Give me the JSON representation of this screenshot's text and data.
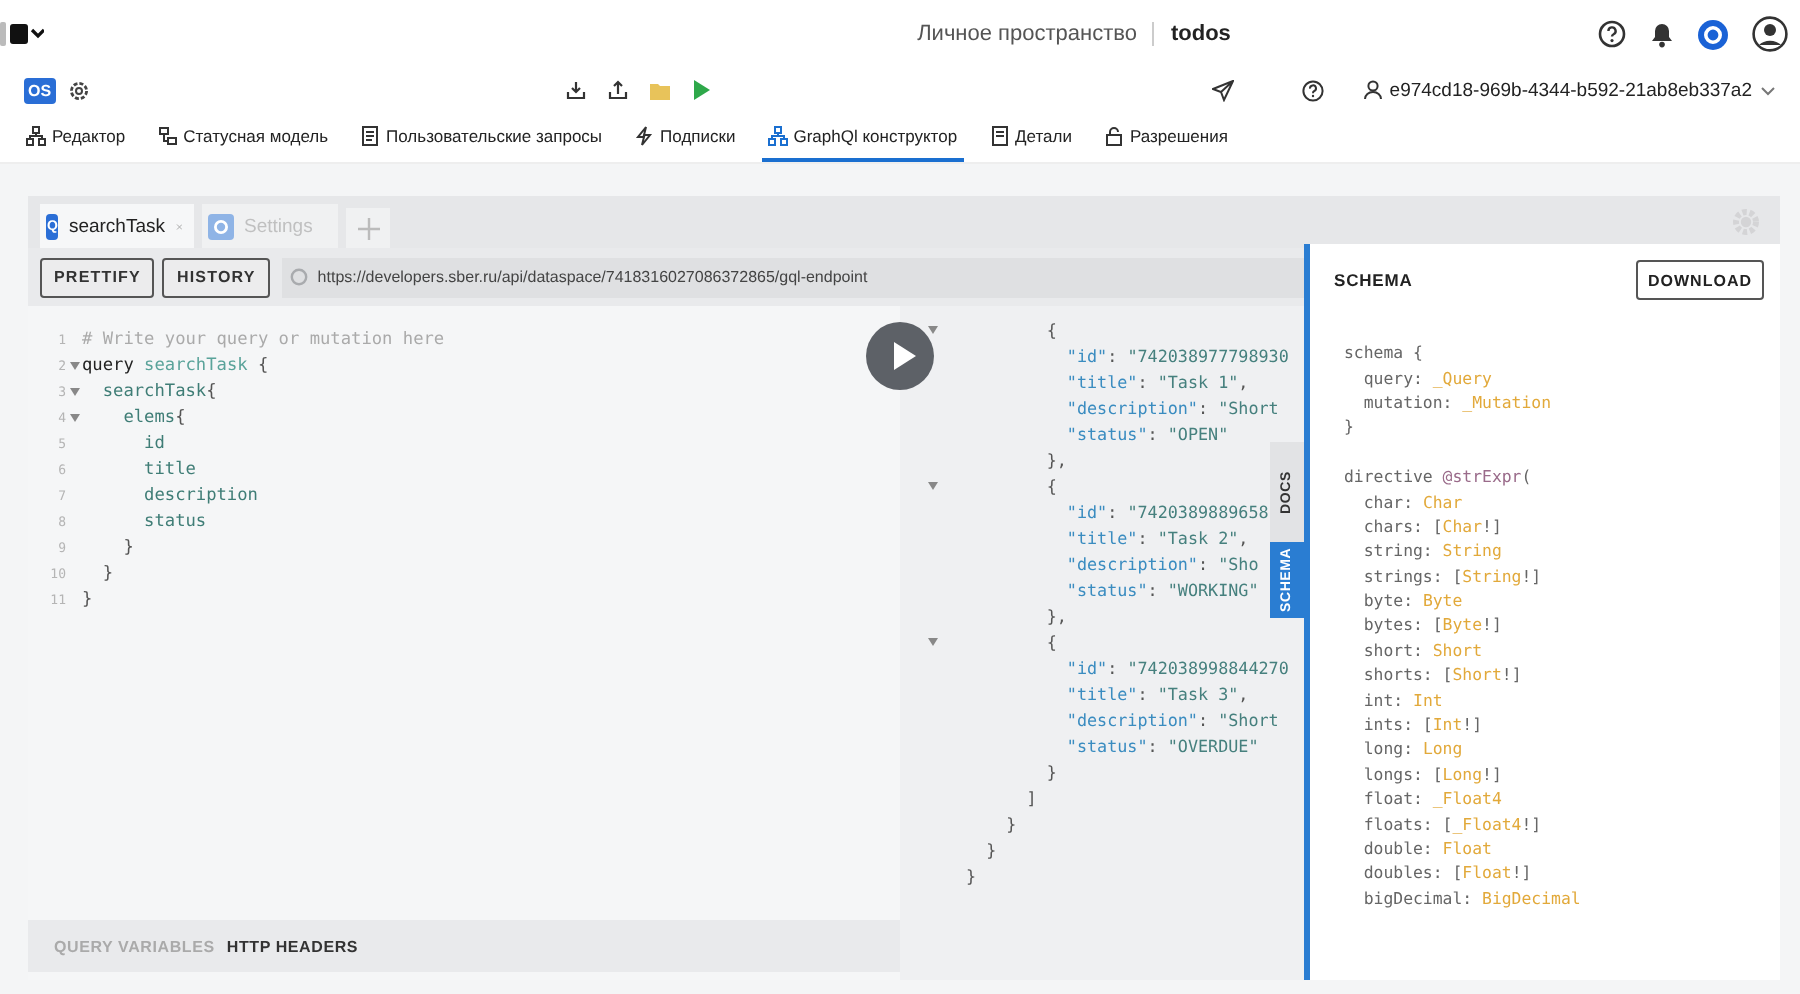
{
  "header": {
    "workspace": "Личное пространство",
    "project": "todos"
  },
  "toolbar": {
    "badge": "OS",
    "user_id": "e974cd18-969b-4344-b592-21ab8eb337a2"
  },
  "nav_tabs": [
    {
      "label": "Редактор",
      "selected": false
    },
    {
      "label": "Статусная модель",
      "selected": false
    },
    {
      "label": "Пользовательские запросы",
      "selected": false
    },
    {
      "label": "Подписки",
      "selected": false
    },
    {
      "label": "GraphQl конструктор",
      "selected": true
    },
    {
      "label": "Детали",
      "selected": false
    },
    {
      "label": "Разрешения",
      "selected": false
    }
  ],
  "query_tabs": [
    {
      "kind": "query",
      "badge": "Q",
      "label": "searchTask",
      "selected": true
    },
    {
      "kind": "settings",
      "label": "Settings",
      "selected": false
    }
  ],
  "buttons": [
    "PRETTIFY",
    "HISTORY"
  ],
  "url": "https://developers.sber.ru/api/dataspace/7418316027086372865/gql-endpoint",
  "editor": {
    "lines": [
      {
        "number": "1",
        "foldable": false,
        "tokens": [
          {
            "kind": "comment",
            "text": "# Write your query or mutation here"
          }
        ]
      },
      {
        "number": "2",
        "foldable": true,
        "tokens": [
          {
            "kind": "keyword",
            "text": "query "
          },
          {
            "kind": "def",
            "text": "searchTask"
          },
          {
            "kind": "punct",
            "text": " {"
          }
        ]
      },
      {
        "number": "3",
        "foldable": true,
        "tokens": [
          {
            "kind": "field",
            "text": "  searchTask"
          },
          {
            "kind": "punct",
            "text": "{"
          }
        ]
      },
      {
        "number": "4",
        "foldable": true,
        "tokens": [
          {
            "kind": "field",
            "text": "    elems"
          },
          {
            "kind": "punct",
            "text": "{"
          }
        ]
      },
      {
        "number": "5",
        "foldable": false,
        "tokens": [
          {
            "kind": "field",
            "text": "      id"
          }
        ]
      },
      {
        "number": "6",
        "foldable": false,
        "tokens": [
          {
            "kind": "field",
            "text": "      title"
          }
        ]
      },
      {
        "number": "7",
        "foldable": false,
        "tokens": [
          {
            "kind": "field",
            "text": "      description"
          }
        ]
      },
      {
        "number": "8",
        "foldable": false,
        "tokens": [
          {
            "kind": "field",
            "text": "      status"
          }
        ]
      },
      {
        "number": "9",
        "foldable": false,
        "tokens": [
          {
            "kind": "punct",
            "text": "    }"
          }
        ]
      },
      {
        "number": "10",
        "foldable": false,
        "tokens": [
          {
            "kind": "punct",
            "text": "  }"
          }
        ]
      },
      {
        "number": "11",
        "foldable": false,
        "tokens": [
          {
            "kind": "punct",
            "text": "}"
          }
        ]
      }
    ]
  },
  "result": {
    "lines": [
      {
        "foldable": true,
        "tokens": [
          {
            "kind": "punct",
            "text": "        {"
          }
        ]
      },
      {
        "foldable": false,
        "tokens": [
          {
            "kind": "key",
            "text": "          \"id\""
          },
          {
            "kind": "punct",
            "text": ": "
          },
          {
            "kind": "string",
            "text": "\"742038977798930"
          }
        ]
      },
      {
        "foldable": false,
        "tokens": [
          {
            "kind": "key",
            "text": "          \"title\""
          },
          {
            "kind": "punct",
            "text": ": "
          },
          {
            "kind": "string",
            "text": "\"Task 1\""
          },
          {
            "kind": "punct",
            "text": ","
          }
        ]
      },
      {
        "foldable": false,
        "tokens": [
          {
            "kind": "key",
            "text": "          \"description\""
          },
          {
            "kind": "punct",
            "text": ": "
          },
          {
            "kind": "string",
            "text": "\"Short"
          }
        ]
      },
      {
        "foldable": false,
        "tokens": [
          {
            "kind": "key",
            "text": "          \"status\""
          },
          {
            "kind": "punct",
            "text": ": "
          },
          {
            "kind": "string",
            "text": "\"OPEN\""
          }
        ]
      },
      {
        "foldable": false,
        "tokens": [
          {
            "kind": "punct",
            "text": "        },"
          }
        ]
      },
      {
        "foldable": true,
        "tokens": [
          {
            "kind": "punct",
            "text": "        {"
          }
        ]
      },
      {
        "foldable": false,
        "tokens": [
          {
            "kind": "key",
            "text": "          \"id\""
          },
          {
            "kind": "punct",
            "text": ": "
          },
          {
            "kind": "string",
            "text": "\"7420389889658"
          }
        ]
      },
      {
        "foldable": false,
        "tokens": [
          {
            "kind": "key",
            "text": "          \"title\""
          },
          {
            "kind": "punct",
            "text": ": "
          },
          {
            "kind": "string",
            "text": "\"Task 2\""
          },
          {
            "kind": "punct",
            "text": ","
          }
        ]
      },
      {
        "foldable": false,
        "tokens": [
          {
            "kind": "key",
            "text": "          \"description\""
          },
          {
            "kind": "punct",
            "text": ": "
          },
          {
            "kind": "string",
            "text": "\"Sho"
          }
        ]
      },
      {
        "foldable": false,
        "tokens": [
          {
            "kind": "key",
            "text": "          \"status\""
          },
          {
            "kind": "punct",
            "text": ": "
          },
          {
            "kind": "string",
            "text": "\"WORKING\""
          }
        ]
      },
      {
        "foldable": false,
        "tokens": [
          {
            "kind": "punct",
            "text": "        },"
          }
        ]
      },
      {
        "foldable": true,
        "tokens": [
          {
            "kind": "punct",
            "text": "        {"
          }
        ]
      },
      {
        "foldable": false,
        "tokens": [
          {
            "kind": "key",
            "text": "          \"id\""
          },
          {
            "kind": "punct",
            "text": ": "
          },
          {
            "kind": "string",
            "text": "\"742038998844270"
          }
        ]
      },
      {
        "foldable": false,
        "tokens": [
          {
            "kind": "key",
            "text": "          \"title\""
          },
          {
            "kind": "punct",
            "text": ": "
          },
          {
            "kind": "string",
            "text": "\"Task 3\""
          },
          {
            "kind": "punct",
            "text": ","
          }
        ]
      },
      {
        "foldable": false,
        "tokens": [
          {
            "kind": "key",
            "text": "          \"description\""
          },
          {
            "kind": "punct",
            "text": ": "
          },
          {
            "kind": "string",
            "text": "\"Short"
          }
        ]
      },
      {
        "foldable": false,
        "tokens": [
          {
            "kind": "key",
            "text": "          \"status\""
          },
          {
            "kind": "punct",
            "text": ": "
          },
          {
            "kind": "string",
            "text": "\"OVERDUE\""
          }
        ]
      },
      {
        "foldable": false,
        "tokens": [
          {
            "kind": "punct",
            "text": "        }"
          }
        ]
      },
      {
        "foldable": false,
        "tokens": [
          {
            "kind": "punct",
            "text": "      ]"
          }
        ]
      },
      {
        "foldable": false,
        "tokens": [
          {
            "kind": "punct",
            "text": "    }"
          }
        ]
      },
      {
        "foldable": false,
        "tokens": [
          {
            "kind": "punct",
            "text": "  }"
          }
        ]
      },
      {
        "foldable": false,
        "tokens": [
          {
            "kind": "punct",
            "text": "}"
          }
        ]
      }
    ]
  },
  "side_tabs": [
    {
      "label": "DOCS",
      "selected": false
    },
    {
      "label": "SCHEMA",
      "selected": true
    }
  ],
  "bottom_tabs": [
    {
      "label": "QUERY VARIABLES",
      "selected": false
    },
    {
      "label": "HTTP HEADERS",
      "selected": true
    }
  ],
  "schema": {
    "title": "SCHEMA",
    "download": "DOWNLOAD",
    "blocks": [
      [
        [
          {
            "kind": "plain",
            "text": "schema {"
          }
        ],
        [
          {
            "kind": "plain",
            "text": "  query: "
          },
          {
            "kind": "type",
            "text": "_Query"
          }
        ],
        [
          {
            "kind": "plain",
            "text": "  mutation: "
          },
          {
            "kind": "type",
            "text": "_Mutation"
          }
        ],
        [
          {
            "kind": "plain",
            "text": "}"
          }
        ]
      ],
      [
        [
          {
            "kind": "plain",
            "text": "directive "
          },
          {
            "kind": "directive",
            "text": "@strExpr"
          },
          {
            "kind": "plain",
            "text": "("
          }
        ],
        [
          {
            "kind": "plain",
            "text": "  char: "
          },
          {
            "kind": "type",
            "text": "Char"
          }
        ],
        [
          {
            "kind": "plain",
            "text": "  chars: ["
          },
          {
            "kind": "type",
            "text": "Char"
          },
          {
            "kind": "plain",
            "text": "!]"
          }
        ],
        [
          {
            "kind": "plain",
            "text": "  string: "
          },
          {
            "kind": "type",
            "text": "String"
          }
        ],
        [
          {
            "kind": "plain",
            "text": "  strings: ["
          },
          {
            "kind": "type",
            "text": "String"
          },
          {
            "kind": "plain",
            "text": "!]"
          }
        ],
        [
          {
            "kind": "plain",
            "text": "  byte: "
          },
          {
            "kind": "type",
            "text": "Byte"
          }
        ],
        [
          {
            "kind": "plain",
            "text": "  bytes: ["
          },
          {
            "kind": "type",
            "text": "Byte"
          },
          {
            "kind": "plain",
            "text": "!]"
          }
        ],
        [
          {
            "kind": "plain",
            "text": "  short: "
          },
          {
            "kind": "type",
            "text": "Short"
          }
        ],
        [
          {
            "kind": "plain",
            "text": "  shorts: ["
          },
          {
            "kind": "type",
            "text": "Short"
          },
          {
            "kind": "plain",
            "text": "!]"
          }
        ],
        [
          {
            "kind": "plain",
            "text": "  int: "
          },
          {
            "kind": "type",
            "text": "Int"
          }
        ],
        [
          {
            "kind": "plain",
            "text": "  ints: ["
          },
          {
            "kind": "type",
            "text": "Int"
          },
          {
            "kind": "plain",
            "text": "!]"
          }
        ],
        [
          {
            "kind": "plain",
            "text": "  long: "
          },
          {
            "kind": "type",
            "text": "Long"
          }
        ],
        [
          {
            "kind": "plain",
            "text": "  longs: ["
          },
          {
            "kind": "type",
            "text": "Long"
          },
          {
            "kind": "plain",
            "text": "!]"
          }
        ],
        [
          {
            "kind": "plain",
            "text": "  float: "
          },
          {
            "kind": "type",
            "text": "_Float4"
          }
        ],
        [
          {
            "kind": "plain",
            "text": "  floats: ["
          },
          {
            "kind": "type",
            "text": "_Float4"
          },
          {
            "kind": "plain",
            "text": "!]"
          }
        ],
        [
          {
            "kind": "plain",
            "text": "  double: "
          },
          {
            "kind": "type",
            "text": "Float"
          }
        ],
        [
          {
            "kind": "plain",
            "text": "  doubles: ["
          },
          {
            "kind": "type",
            "text": "Float"
          },
          {
            "kind": "plain",
            "text": "!]"
          }
        ],
        [
          {
            "kind": "plain",
            "text": "  bigDecimal: "
          },
          {
            "kind": "type",
            "text": "BigDecimal"
          }
        ]
      ]
    ]
  }
}
